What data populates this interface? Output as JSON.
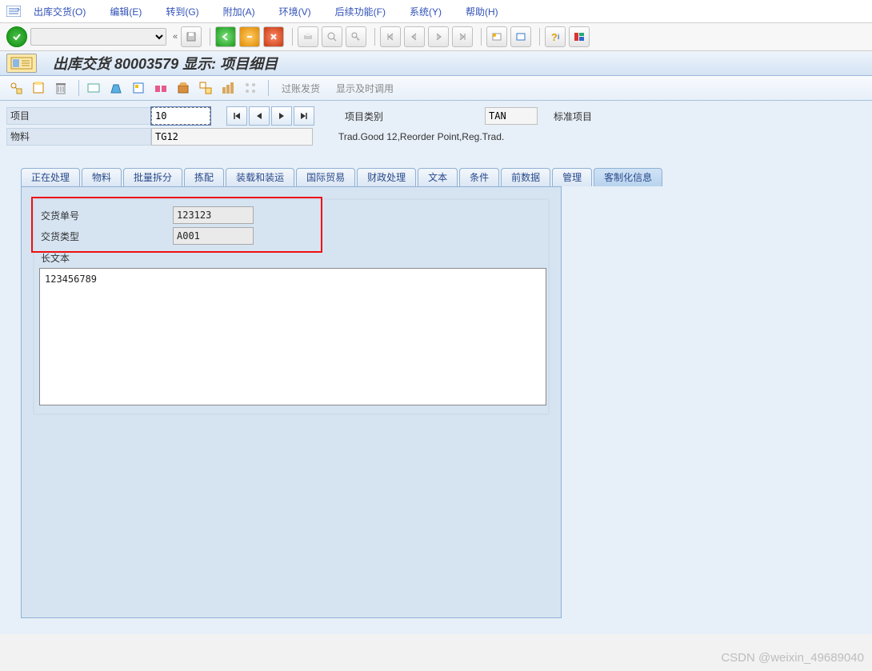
{
  "menu": {
    "items": [
      "出库交货(O)",
      "编辑(E)",
      "转到(G)",
      "附加(A)",
      "环境(V)",
      "后续功能(F)",
      "系统(Y)",
      "帮助(H)"
    ]
  },
  "toolbar_select": "",
  "title": "出库交货 80003579 显示: 项目细目",
  "apptb": {
    "post_goods": "过账发货",
    "display_jit": "显示及时调用"
  },
  "form": {
    "item_label": "项目",
    "item_value": "10",
    "cat_label": "项目类别",
    "cat_value": "TAN",
    "cat_text": "标准项目",
    "mat_label": "物料",
    "mat_value": "TG12",
    "mat_text": "Trad.Good 12,Reorder Point,Reg.Trad."
  },
  "tabs": [
    "正在处理",
    "物料",
    "批量拆分",
    "拣配",
    "装载和装运",
    "国际贸易",
    "财政处理",
    "文本",
    "条件",
    "前数据",
    "管理",
    "客制化信息"
  ],
  "custom": {
    "del_no_label": "交货单号",
    "del_no_value": "123123",
    "del_type_label": "交货类型",
    "del_type_value": "A001",
    "longtext_label": "长文本",
    "longtext_value": "123456789"
  },
  "watermark": "CSDN @weixin_49689040"
}
